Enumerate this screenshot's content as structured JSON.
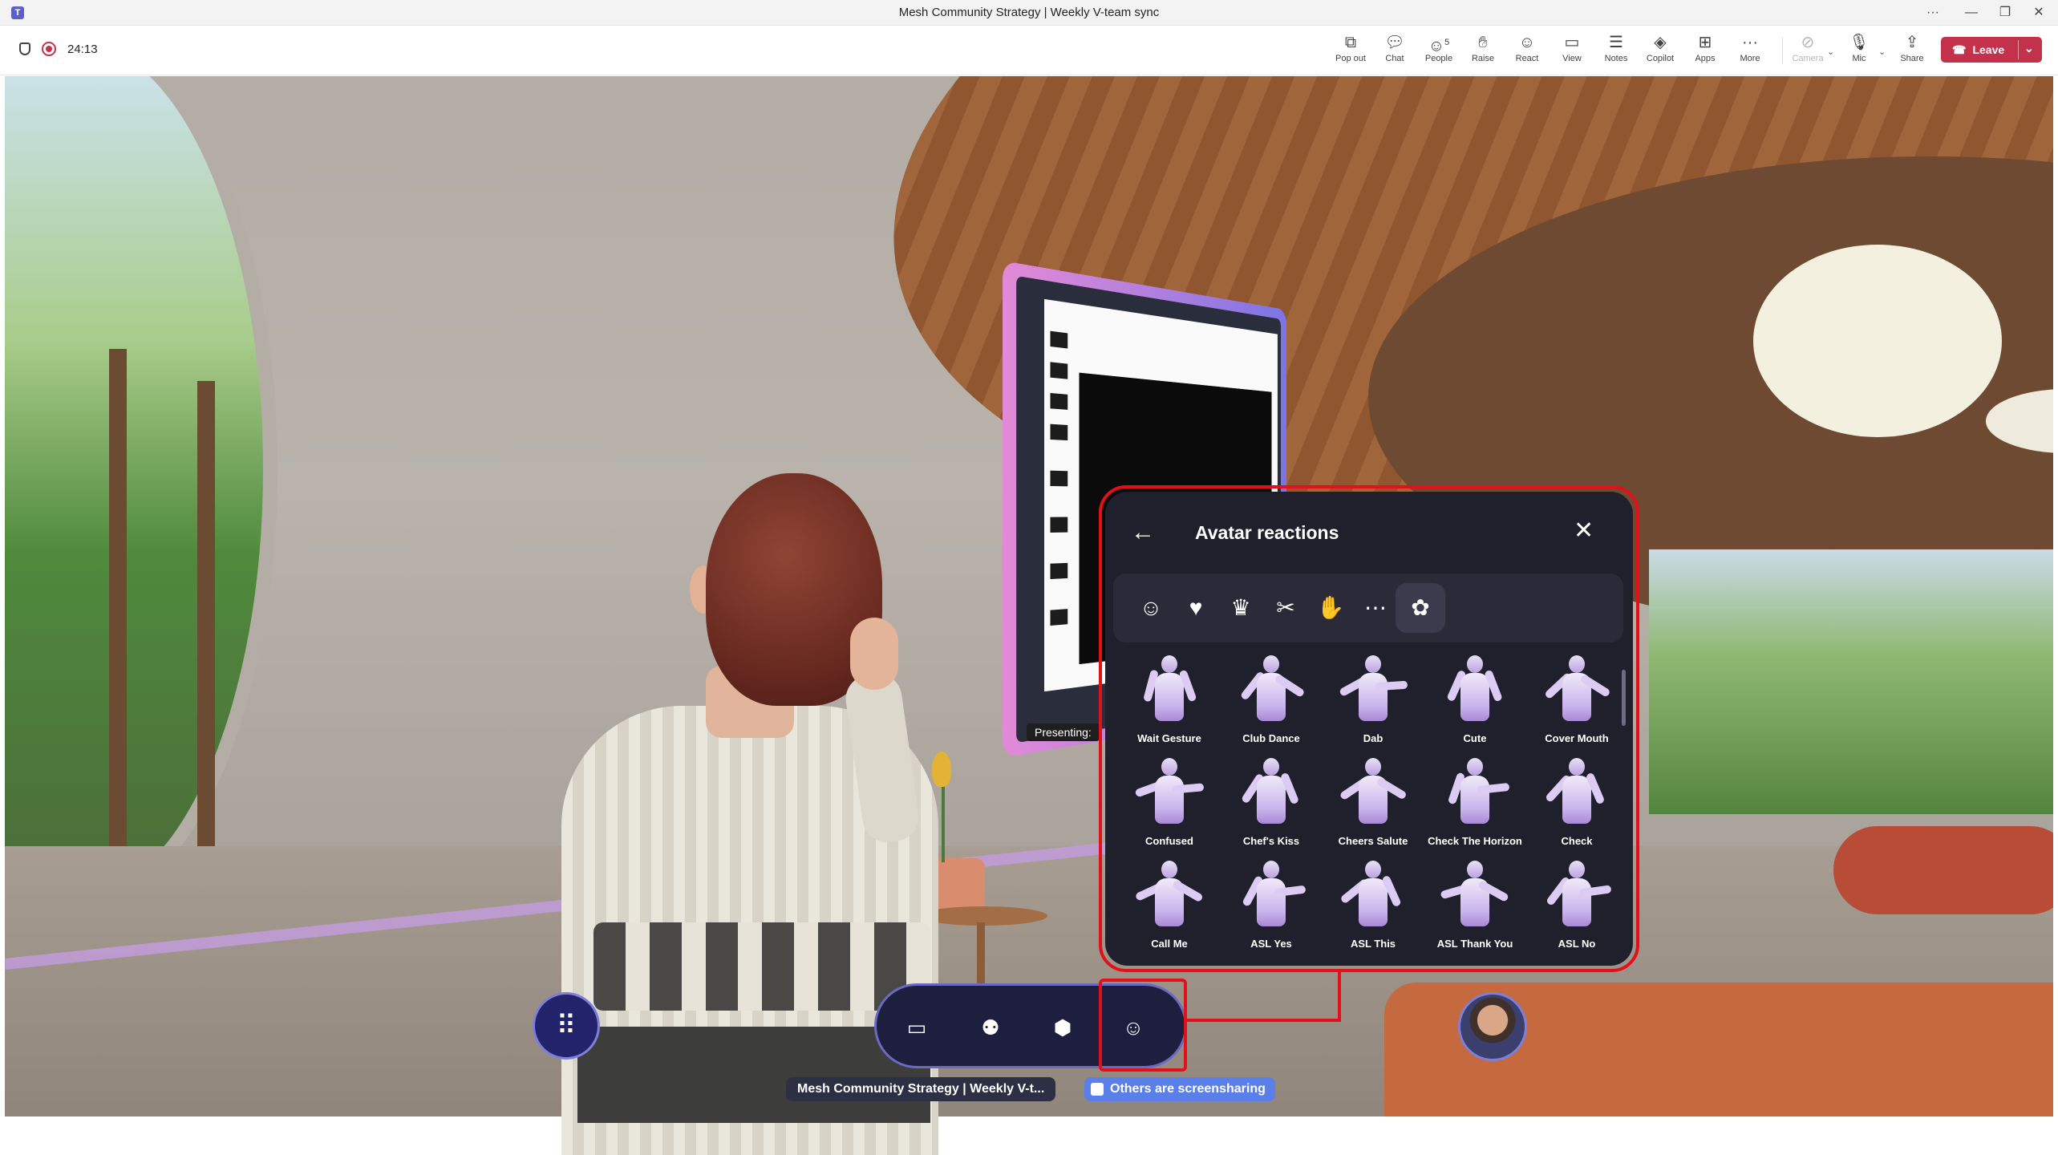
{
  "window": {
    "title": "Mesh Community Strategy | Weekly V-team sync",
    "app_icon": "T",
    "controls": [
      "···",
      "—",
      "❐",
      "✕"
    ]
  },
  "meeting": {
    "elapsed": "24:13"
  },
  "toolbar": {
    "popout": "Pop out",
    "chat": "Chat",
    "people": "People",
    "people_count": "5",
    "raise": "Raise",
    "react": "React",
    "view": "View",
    "notes": "Notes",
    "copilot": "Copilot",
    "apps": "Apps",
    "more": "More",
    "camera": "Camera",
    "mic": "Mic",
    "share": "Share",
    "leave": "Leave"
  },
  "scene": {
    "presenting_label": "Presenting:"
  },
  "reactions_panel": {
    "title": "Avatar reactions",
    "back_icon": "arrow-left-icon",
    "close_icon": "close-icon",
    "categories": [
      {
        "icon": "smiley-icon",
        "glyph": "☺"
      },
      {
        "icon": "dance-icon",
        "glyph": "♥"
      },
      {
        "icon": "trophy-icon",
        "glyph": "♛"
      },
      {
        "icon": "gesture-icon",
        "glyph": "✂"
      },
      {
        "icon": "hand-icon",
        "glyph": "✋"
      },
      {
        "icon": "more-circle-icon",
        "glyph": "⋯"
      },
      {
        "icon": "sign-language-icon",
        "glyph": "✿"
      }
    ],
    "active_category": 6,
    "reactions": [
      "Wait Gesture",
      "Club Dance",
      "Dab",
      "Cute",
      "Cover Mouth",
      "Confused",
      "Chef's Kiss",
      "Cheers Salute",
      "Check The Horizon",
      "Check",
      "Call Me",
      "ASL Yes",
      "ASL This",
      "ASL Thank You",
      "ASL No"
    ]
  },
  "bottom_bar": {
    "meeting_name": "Mesh Community Strategy | Weekly V-t...",
    "sharing_status": "Others are screensharing"
  },
  "colors": {
    "leave": "#c4314b",
    "highlight": "#e3101a",
    "panel_bg": "#20202c",
    "dock_bg": "#1e1e3e",
    "sharing_pill": "#5b7fe8"
  }
}
